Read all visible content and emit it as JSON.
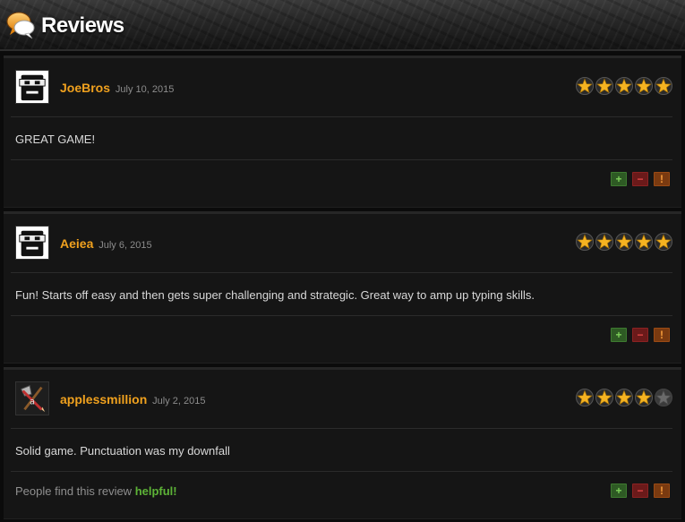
{
  "header": {
    "title": "Reviews",
    "icon": "speech-bubble-icon"
  },
  "colors": {
    "accent": "#f0a11e",
    "helpful": "#5db337",
    "plus": "#7ed05a",
    "minus": "#e04848",
    "flag": "#f39a3a"
  },
  "reviews": [
    {
      "username": "JoeBros",
      "date": "July 10, 2015",
      "rating": 5,
      "max_rating": 5,
      "text": "GREAT GAME!",
      "avatar": "masked-face-avatar",
      "helpful_prefix": "",
      "helpful_word": ""
    },
    {
      "username": "Aeiea",
      "date": "July 6, 2015",
      "rating": 5,
      "max_rating": 5,
      "text": "Fun! Starts off easy and then gets super challenging and strategic. Great way to amp up typing skills.",
      "avatar": "masked-face-avatar",
      "helpful_prefix": "",
      "helpful_word": ""
    },
    {
      "username": "applessmillion",
      "date": "July 2, 2015",
      "rating": 4,
      "max_rating": 5,
      "text": "Solid game. Punctuation was my downfall",
      "avatar": "axe-and-pencil-avatar",
      "helpful_prefix": "People find this review ",
      "helpful_word": "helpful!"
    }
  ],
  "vote_buttons": {
    "plus": "+",
    "minus": "−",
    "flag": "!"
  }
}
